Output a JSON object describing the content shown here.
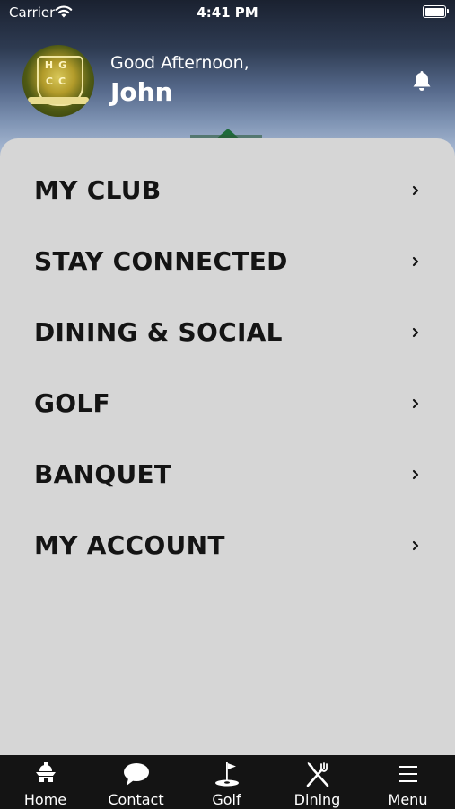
{
  "status_bar": {
    "carrier": "Carrier",
    "time": "4:41 PM"
  },
  "header": {
    "logo_letters": [
      "H",
      "G",
      "C",
      "C"
    ],
    "greeting": "Good Afternoon,",
    "user_name": "John",
    "notification_icon": "bell-icon"
  },
  "menu": {
    "items": [
      {
        "label": "MY CLUB"
      },
      {
        "label": "STAY CONNECTED"
      },
      {
        "label": "DINING & SOCIAL"
      },
      {
        "label": "GOLF"
      },
      {
        "label": "BANQUET"
      },
      {
        "label": "MY ACCOUNT"
      }
    ]
  },
  "tab_bar": {
    "tabs": [
      {
        "label": "Home",
        "icon": "clubhouse-icon"
      },
      {
        "label": "Contact",
        "icon": "chat-bubble-icon"
      },
      {
        "label": "Golf",
        "icon": "golf-flag-icon"
      },
      {
        "label": "Dining",
        "icon": "fork-knife-icon"
      },
      {
        "label": "Menu",
        "icon": "hamburger-icon"
      }
    ]
  },
  "colors": {
    "panel": "#d6d6d6",
    "tab_bar": "#141414",
    "text": "#141414"
  }
}
